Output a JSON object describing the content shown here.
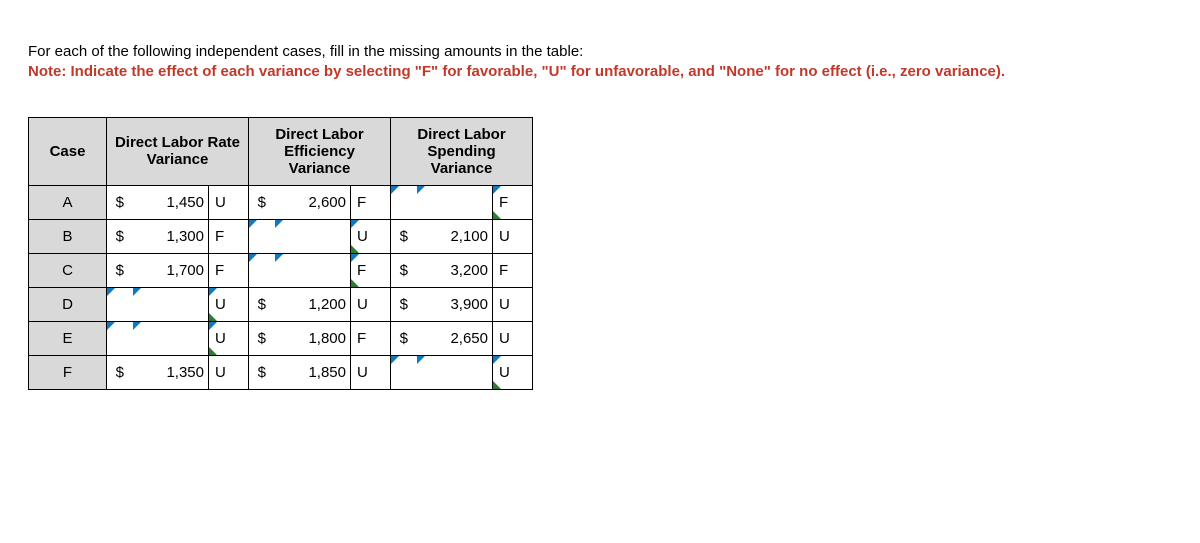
{
  "instructions": {
    "line1": "For each of the following independent cases, fill in the missing amounts in the table:",
    "note": "Note: Indicate the effect of each variance by selecting \"F\" for favorable, \"U\" for unfavorable, and \"None\" for no effect (i.e., zero variance)."
  },
  "headers": {
    "case": "Case",
    "rate": "Direct Labor Rate Variance",
    "efficiency": "Direct Labor Efficiency Variance",
    "spending": "Direct Labor Spending Variance"
  },
  "rows": [
    {
      "case": "A",
      "rate": {
        "dollar": "$",
        "amount": "1,450",
        "fu": "U",
        "dollarEditable": false,
        "amountEditable": false,
        "fuEditable": false,
        "fuMarked": false
      },
      "efficiency": {
        "dollar": "$",
        "amount": "2,600",
        "fu": "F",
        "dollarEditable": false,
        "amountEditable": false,
        "fuEditable": false,
        "fuMarked": false
      },
      "spending": {
        "dollar": "",
        "amount": "",
        "fu": "F",
        "dollarEditable": true,
        "amountEditable": true,
        "fuEditable": true,
        "fuMarked": true
      }
    },
    {
      "case": "B",
      "rate": {
        "dollar": "$",
        "amount": "1,300",
        "fu": "F",
        "dollarEditable": false,
        "amountEditable": false,
        "fuEditable": false,
        "fuMarked": false
      },
      "efficiency": {
        "dollar": "",
        "amount": "",
        "fu": "U",
        "dollarEditable": true,
        "amountEditable": true,
        "fuEditable": true,
        "fuMarked": true
      },
      "spending": {
        "dollar": "$",
        "amount": "2,100",
        "fu": "U",
        "dollarEditable": false,
        "amountEditable": false,
        "fuEditable": false,
        "fuMarked": false
      }
    },
    {
      "case": "C",
      "rate": {
        "dollar": "$",
        "amount": "1,700",
        "fu": "F",
        "dollarEditable": false,
        "amountEditable": false,
        "fuEditable": false,
        "fuMarked": false
      },
      "efficiency": {
        "dollar": "",
        "amount": "",
        "fu": "F",
        "dollarEditable": true,
        "amountEditable": true,
        "fuEditable": true,
        "fuMarked": true
      },
      "spending": {
        "dollar": "$",
        "amount": "3,200",
        "fu": "F",
        "dollarEditable": false,
        "amountEditable": false,
        "fuEditable": false,
        "fuMarked": false
      }
    },
    {
      "case": "D",
      "rate": {
        "dollar": "",
        "amount": "",
        "fu": "U",
        "dollarEditable": true,
        "amountEditable": true,
        "fuEditable": true,
        "fuMarked": true
      },
      "efficiency": {
        "dollar": "$",
        "amount": "1,200",
        "fu": "U",
        "dollarEditable": false,
        "amountEditable": false,
        "fuEditable": false,
        "fuMarked": false
      },
      "spending": {
        "dollar": "$",
        "amount": "3,900",
        "fu": "U",
        "dollarEditable": false,
        "amountEditable": false,
        "fuEditable": false,
        "fuMarked": false
      }
    },
    {
      "case": "E",
      "rate": {
        "dollar": "",
        "amount": "",
        "fu": "U",
        "dollarEditable": true,
        "amountEditable": true,
        "fuEditable": true,
        "fuMarked": true
      },
      "efficiency": {
        "dollar": "$",
        "amount": "1,800",
        "fu": "F",
        "dollarEditable": false,
        "amountEditable": false,
        "fuEditable": false,
        "fuMarked": false
      },
      "spending": {
        "dollar": "$",
        "amount": "2,650",
        "fu": "U",
        "dollarEditable": false,
        "amountEditable": false,
        "fuEditable": false,
        "fuMarked": false
      }
    },
    {
      "case": "F",
      "rate": {
        "dollar": "$",
        "amount": "1,350",
        "fu": "U",
        "dollarEditable": false,
        "amountEditable": false,
        "fuEditable": false,
        "fuMarked": false
      },
      "efficiency": {
        "dollar": "$",
        "amount": "1,850",
        "fu": "U",
        "dollarEditable": false,
        "amountEditable": false,
        "fuEditable": false,
        "fuMarked": false
      },
      "spending": {
        "dollar": "",
        "amount": "",
        "fu": "U",
        "dollarEditable": true,
        "amountEditable": true,
        "fuEditable": true,
        "fuMarked": true
      }
    }
  ]
}
